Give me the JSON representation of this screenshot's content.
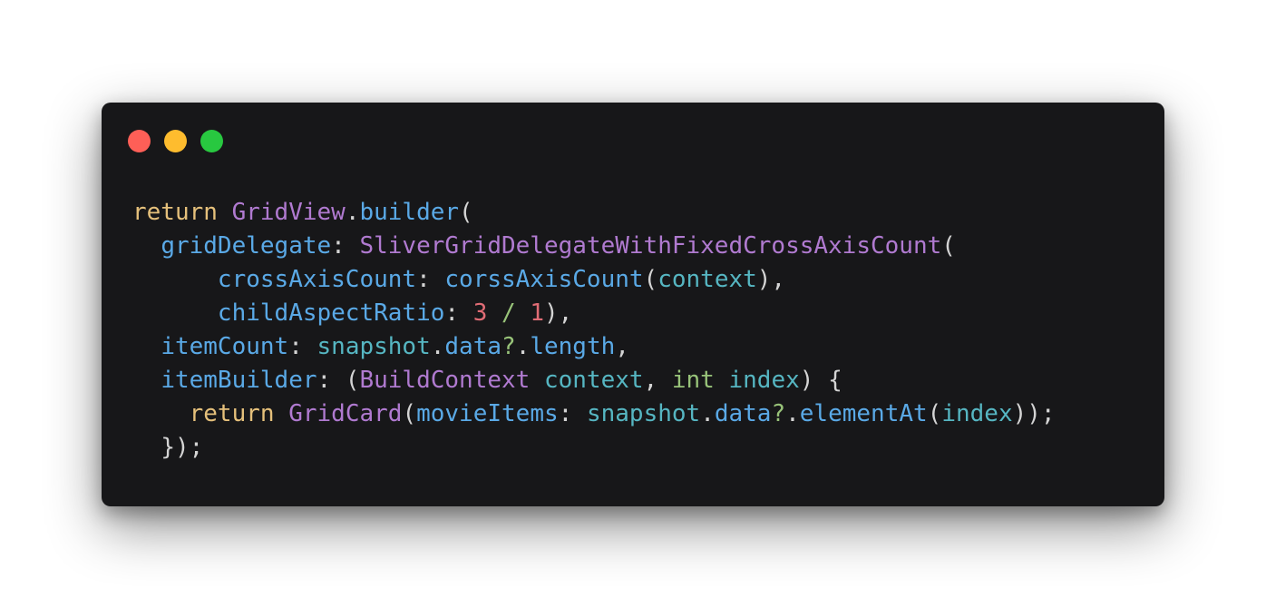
{
  "window": {
    "controls": {
      "close": "close",
      "minimize": "minimize",
      "maximize": "maximize"
    },
    "colors": {
      "background": "#171719",
      "close": "#fe5f57",
      "minimize": "#febc2e",
      "maximize": "#28c840"
    }
  },
  "code": {
    "language": "dart",
    "lines": [
      [
        {
          "t": "return",
          "c": "kw"
        },
        {
          "t": " ",
          "c": "pn"
        },
        {
          "t": "GridView",
          "c": "cls"
        },
        {
          "t": ".",
          "c": "pn"
        },
        {
          "t": "builder",
          "c": "prop"
        },
        {
          "t": "(",
          "c": "pn"
        }
      ],
      [
        {
          "t": "  ",
          "c": "pn"
        },
        {
          "t": "gridDelegate",
          "c": "prop"
        },
        {
          "t": ": ",
          "c": "pn"
        },
        {
          "t": "SliverGridDelegateWithFixedCrossAxisCount",
          "c": "cls"
        },
        {
          "t": "(",
          "c": "pn"
        }
      ],
      [
        {
          "t": "      ",
          "c": "pn"
        },
        {
          "t": "crossAxisCount",
          "c": "prop"
        },
        {
          "t": ": ",
          "c": "pn"
        },
        {
          "t": "corssAxisCount",
          "c": "prop"
        },
        {
          "t": "(",
          "c": "pn"
        },
        {
          "t": "context",
          "c": "id"
        },
        {
          "t": "),",
          "c": "pn"
        }
      ],
      [
        {
          "t": "      ",
          "c": "pn"
        },
        {
          "t": "childAspectRatio",
          "c": "prop"
        },
        {
          "t": ": ",
          "c": "pn"
        },
        {
          "t": "3",
          "c": "num"
        },
        {
          "t": " ",
          "c": "pn"
        },
        {
          "t": "/",
          "c": "op"
        },
        {
          "t": " ",
          "c": "pn"
        },
        {
          "t": "1",
          "c": "num"
        },
        {
          "t": "),",
          "c": "pn"
        }
      ],
      [
        {
          "t": "  ",
          "c": "pn"
        },
        {
          "t": "itemCount",
          "c": "prop"
        },
        {
          "t": ": ",
          "c": "pn"
        },
        {
          "t": "snapshot",
          "c": "id"
        },
        {
          "t": ".",
          "c": "pn"
        },
        {
          "t": "data",
          "c": "prop"
        },
        {
          "t": "?",
          "c": "op"
        },
        {
          "t": ".",
          "c": "pn"
        },
        {
          "t": "length",
          "c": "prop"
        },
        {
          "t": ",",
          "c": "pn"
        }
      ],
      [
        {
          "t": "  ",
          "c": "pn"
        },
        {
          "t": "itemBuilder",
          "c": "prop"
        },
        {
          "t": ": (",
          "c": "pn"
        },
        {
          "t": "BuildContext",
          "c": "cls"
        },
        {
          "t": " ",
          "c": "pn"
        },
        {
          "t": "context",
          "c": "id"
        },
        {
          "t": ", ",
          "c": "pn"
        },
        {
          "t": "int",
          "c": "type"
        },
        {
          "t": " ",
          "c": "pn"
        },
        {
          "t": "index",
          "c": "id"
        },
        {
          "t": ") {",
          "c": "pn"
        }
      ],
      [
        {
          "t": "    ",
          "c": "pn"
        },
        {
          "t": "return",
          "c": "kw"
        },
        {
          "t": " ",
          "c": "pn"
        },
        {
          "t": "GridCard",
          "c": "cls"
        },
        {
          "t": "(",
          "c": "pn"
        },
        {
          "t": "movieItems",
          "c": "prop"
        },
        {
          "t": ": ",
          "c": "pn"
        },
        {
          "t": "snapshot",
          "c": "id"
        },
        {
          "t": ".",
          "c": "pn"
        },
        {
          "t": "data",
          "c": "prop"
        },
        {
          "t": "?",
          "c": "op"
        },
        {
          "t": ".",
          "c": "pn"
        },
        {
          "t": "elementAt",
          "c": "prop"
        },
        {
          "t": "(",
          "c": "pn"
        },
        {
          "t": "index",
          "c": "id"
        },
        {
          "t": "));",
          "c": "pn"
        }
      ],
      [
        {
          "t": "  ",
          "c": "pn"
        },
        {
          "t": "});",
          "c": "pn"
        }
      ]
    ]
  }
}
